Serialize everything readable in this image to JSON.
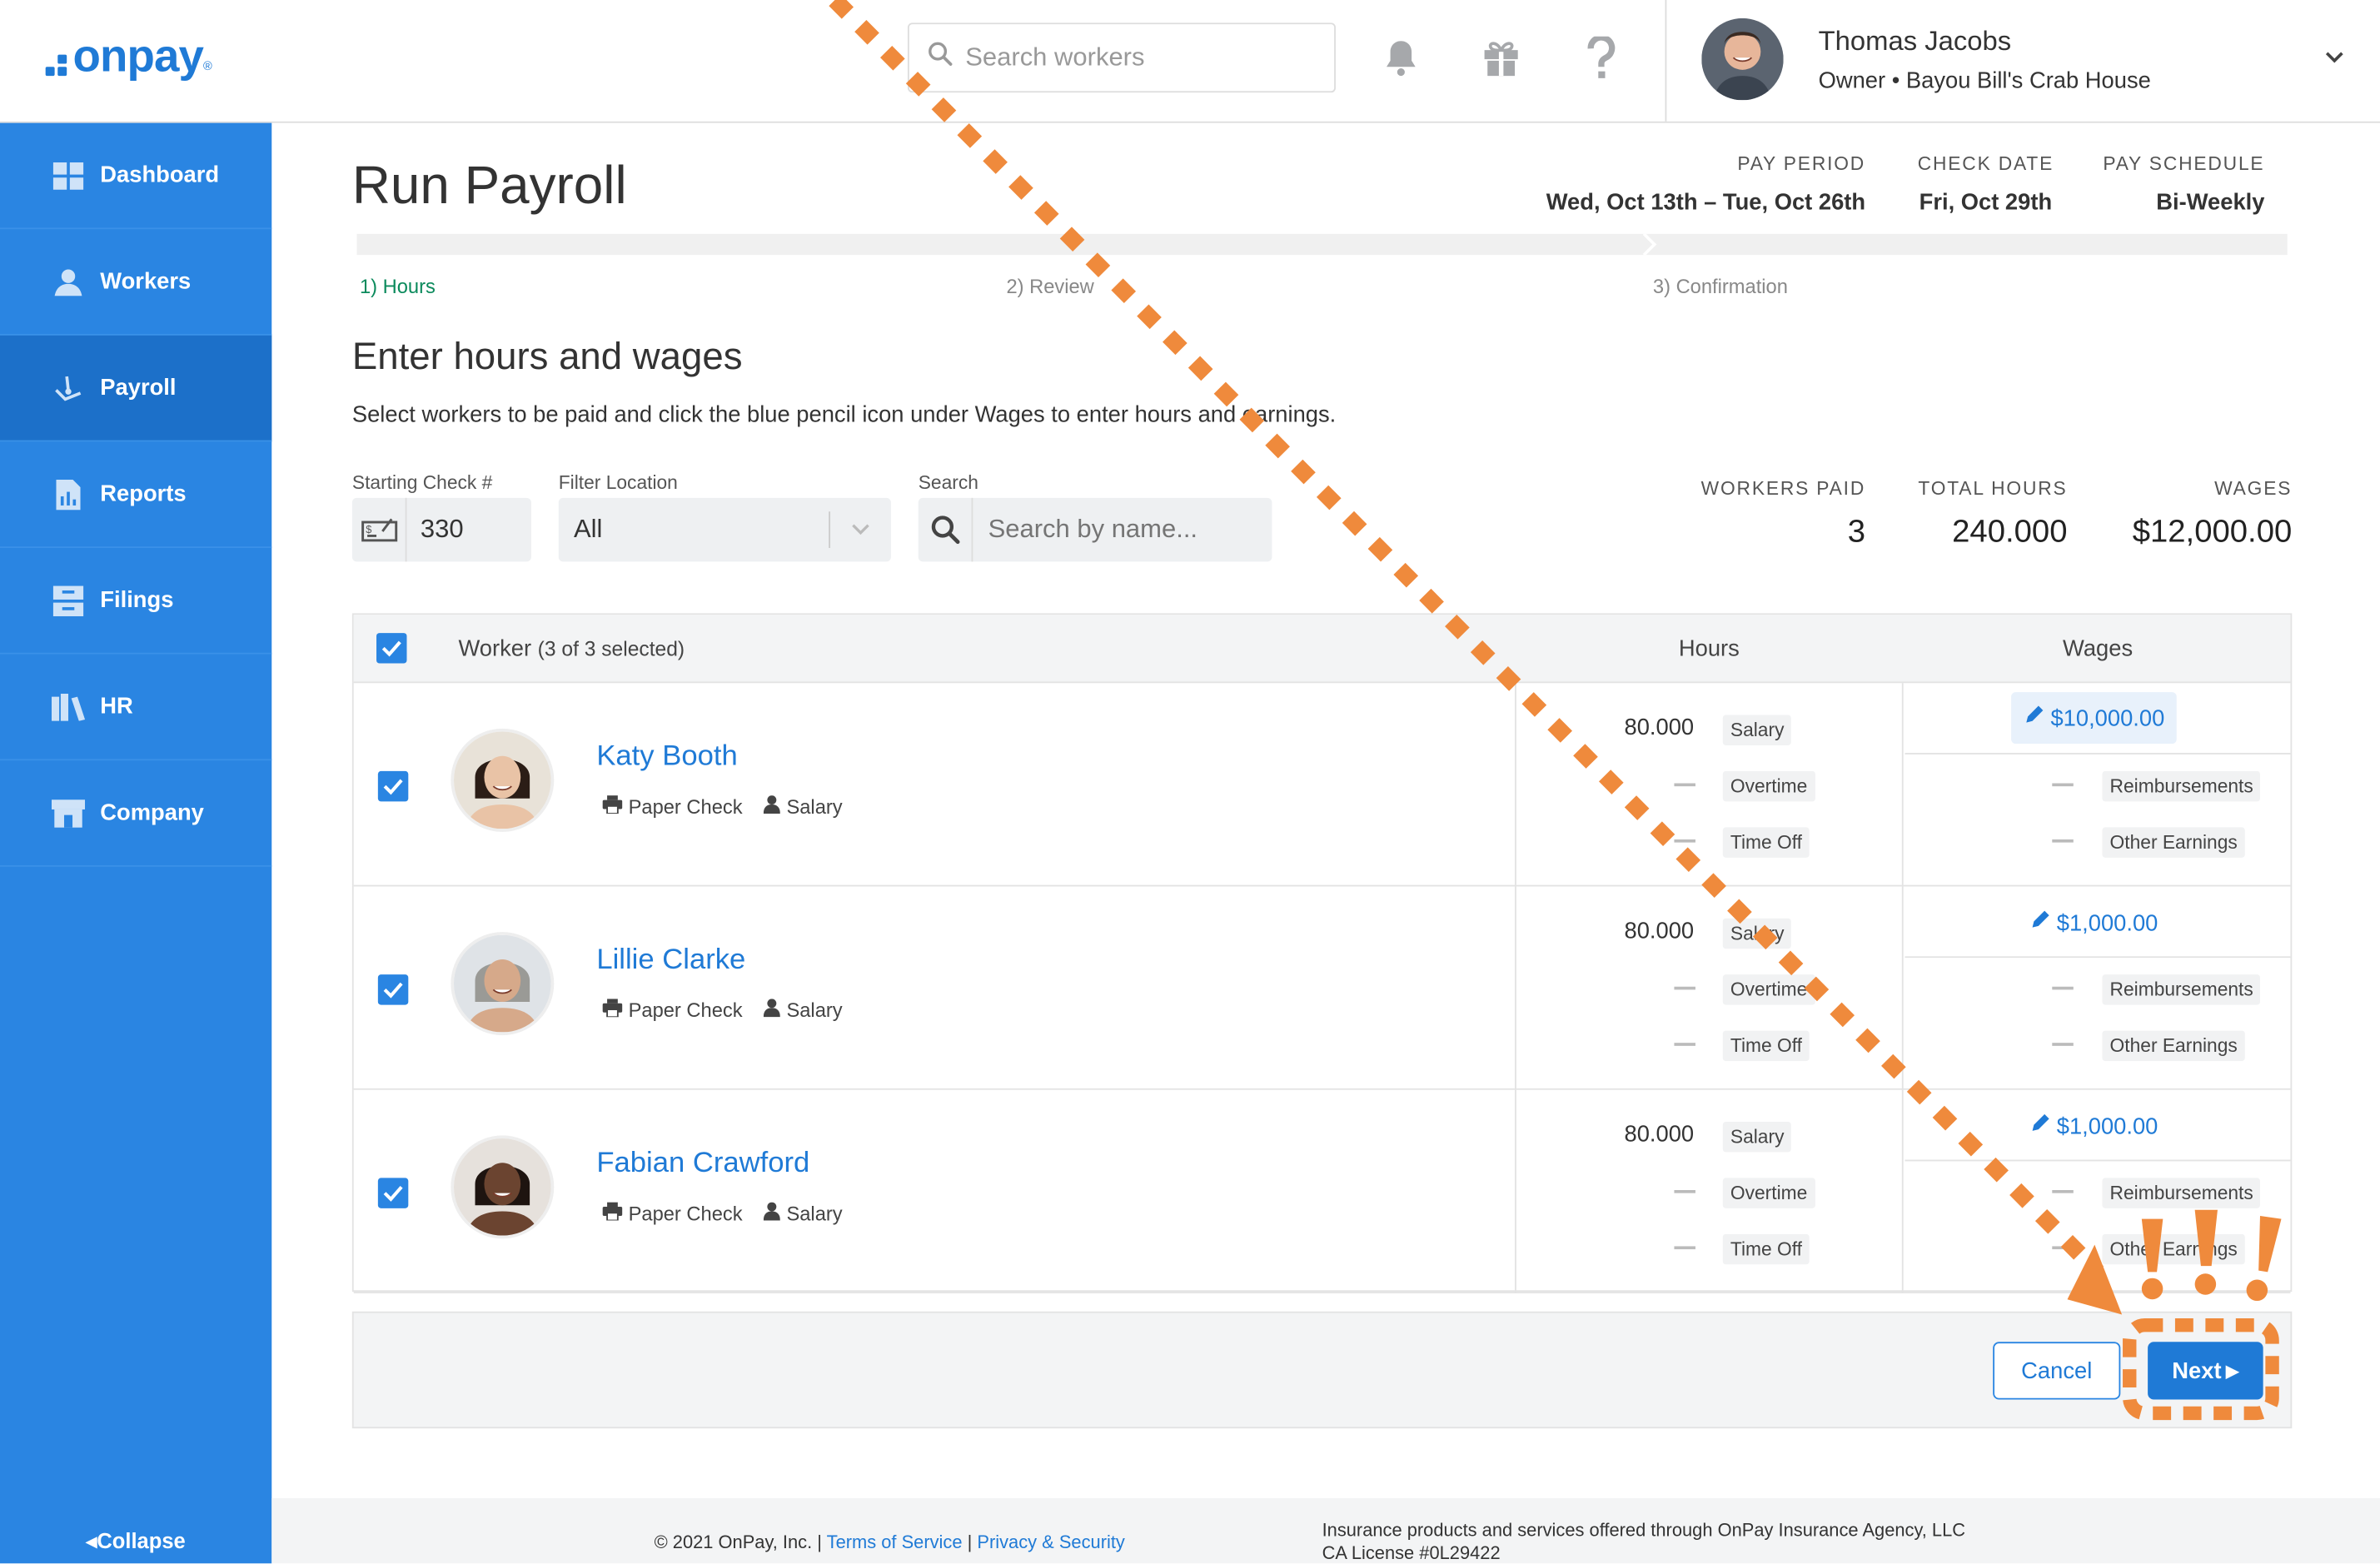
{
  "brand": {
    "logo_text": "onpay",
    "reg": "®",
    "color": "#1f7ad6"
  },
  "header": {
    "search_placeholder": "Search workers",
    "icons": [
      "bell-icon",
      "gift-icon",
      "help-icon"
    ],
    "user_name": "Thomas Jacobs",
    "user_role": "Owner • Bayou Bill's Crab House"
  },
  "sidebar": {
    "items": [
      {
        "label": "Dashboard",
        "icon": "dashboard-icon"
      },
      {
        "label": "Workers",
        "icon": "workers-icon"
      },
      {
        "label": "Payroll",
        "icon": "payroll-icon",
        "active": true
      },
      {
        "label": "Reports",
        "icon": "reports-icon"
      },
      {
        "label": "Filings",
        "icon": "filings-icon"
      },
      {
        "label": "HR",
        "icon": "hr-icon"
      },
      {
        "label": "Company",
        "icon": "company-icon"
      }
    ],
    "collapse": "Collapse"
  },
  "page": {
    "title": "Run Payroll",
    "pay_period_label": "PAY PERIOD",
    "pay_period": "Wed, Oct 13th – Tue, Oct 26th",
    "check_date_label": "CHECK DATE",
    "check_date": "Fri, Oct 29th",
    "pay_schedule_label": "PAY SCHEDULE",
    "pay_schedule": "Bi-Weekly",
    "steps": [
      "1) Hours",
      "2) Review",
      "3) Confirmation"
    ],
    "progress": 0.333,
    "section_title": "Enter hours and wages",
    "instructions": "Select workers to be paid and click the blue pencil icon under Wages to enter hours and earnings."
  },
  "filters": {
    "check_label": "Starting Check #",
    "check_value": "330",
    "location_label": "Filter Location",
    "location_value": "All",
    "search_label": "Search",
    "search_placeholder": "Search by name..."
  },
  "stats": {
    "workers_paid_label": "WORKERS PAID",
    "workers_paid": "3",
    "total_hours_label": "TOTAL HOURS",
    "total_hours": "240.000",
    "wages_label": "WAGES",
    "wages": "$12,000.00"
  },
  "table": {
    "worker_header": "Worker",
    "worker_count": "(3 of 3 selected)",
    "hours_header": "Hours",
    "wages_header": "Wages",
    "rows": [
      {
        "name": "Katy Booth",
        "pay_method": "Paper Check",
        "type": "Salary",
        "hours": "80.000",
        "salary_tag": "Salary",
        "overtime_tag": "Overtime",
        "timeoff_tag": "Time Off",
        "wage": "$10,000.00",
        "reimb_tag": "Reimbursements",
        "other_tag": "Other Earnings"
      },
      {
        "name": "Lillie Clarke",
        "pay_method": "Paper Check",
        "type": "Salary",
        "hours": "80.000",
        "salary_tag": "Salary",
        "overtime_tag": "Overtime",
        "timeoff_tag": "Time Off",
        "wage": "$1,000.00",
        "reimb_tag": "Reimbursements",
        "other_tag": "Other Earnings"
      },
      {
        "name": "Fabian Crawford",
        "pay_method": "Paper Check",
        "type": "Salary",
        "hours": "80.000",
        "salary_tag": "Salary",
        "overtime_tag": "Overtime",
        "timeoff_tag": "Time Off",
        "wage": "$1,000.00",
        "reimb_tag": "Reimbursements",
        "other_tag": "Other Earnings"
      }
    ]
  },
  "actions": {
    "cancel": "Cancel",
    "next": "Next"
  },
  "footer": {
    "copyright": "© 2021 OnPay, Inc. |",
    "terms": "Terms of Service",
    "sep": "|",
    "privacy": "Privacy & Security",
    "insurance_line1": "Insurance products and services offered through OnPay Insurance Agency, LLC",
    "insurance_line2": "CA License #0L29422"
  },
  "annotation": {
    "color": "#ef8a3c"
  }
}
